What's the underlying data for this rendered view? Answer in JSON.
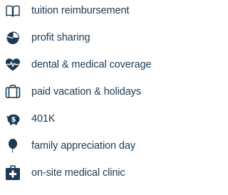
{
  "colors": {
    "text": "#1c3a53",
    "icon": "#1c3a53",
    "icon_inverse": "#ffffff"
  },
  "benefits": {
    "items": [
      {
        "label": "tuition reimbursement",
        "icon": "open-book-icon"
      },
      {
        "label": "profit sharing",
        "icon": "pie-chart-icon"
      },
      {
        "label": "dental & medical coverage",
        "icon": "heart-pulse-icon"
      },
      {
        "label": "paid vacation & holidays",
        "icon": "suitcase-icon"
      },
      {
        "label": "401K",
        "icon": "piggy-bank-dollar-icon"
      },
      {
        "label": "family appreciation day",
        "icon": "balloon-icon"
      },
      {
        "label": "on-site medical clinic",
        "icon": "medical-kit-icon"
      }
    ]
  }
}
